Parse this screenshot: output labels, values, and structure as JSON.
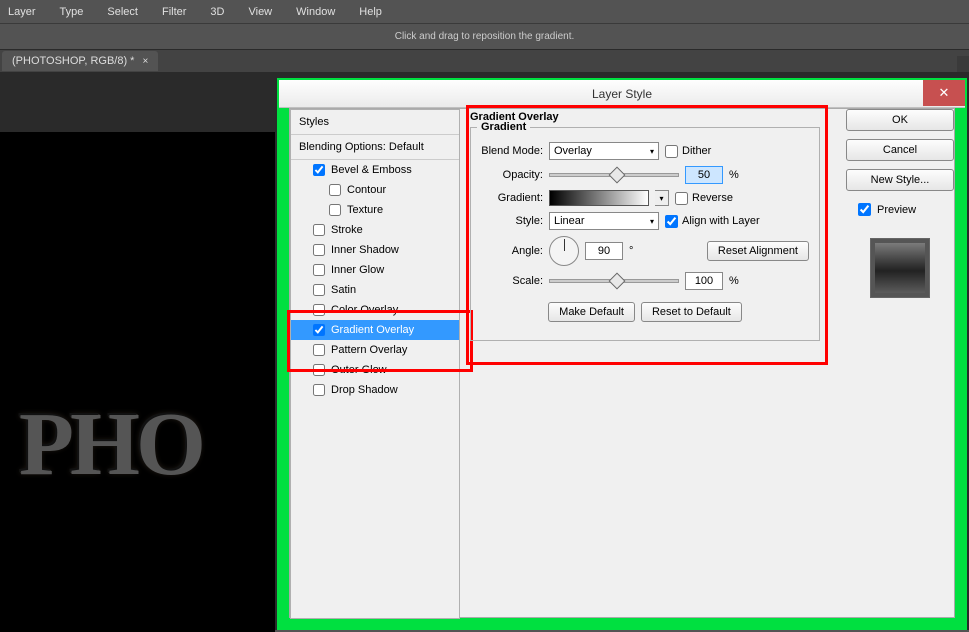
{
  "menu": [
    "Layer",
    "Type",
    "Select",
    "Filter",
    "3D",
    "View",
    "Window",
    "Help"
  ],
  "info": "Click and drag to reposition the gradient.",
  "tab": {
    "label": "(PHOTOSHOP, RGB/8) *"
  },
  "canvas_text": "PHO",
  "dialog": {
    "title": "Layer Style",
    "styles_header": "Styles",
    "blending": "Blending Options: Default",
    "items": [
      {
        "label": "Bevel & Emboss",
        "checked": true,
        "sub": false
      },
      {
        "label": "Contour",
        "checked": false,
        "sub": true
      },
      {
        "label": "Texture",
        "checked": false,
        "sub": true
      },
      {
        "label": "Stroke",
        "checked": false,
        "sub": false
      },
      {
        "label": "Inner Shadow",
        "checked": false,
        "sub": false
      },
      {
        "label": "Inner Glow",
        "checked": false,
        "sub": false
      },
      {
        "label": "Satin",
        "checked": false,
        "sub": false
      },
      {
        "label": "Color Overlay",
        "checked": false,
        "sub": false
      },
      {
        "label": "Gradient Overlay",
        "checked": true,
        "sub": false,
        "selected": true
      },
      {
        "label": "Pattern Overlay",
        "checked": false,
        "sub": false
      },
      {
        "label": "Outer Glow",
        "checked": false,
        "sub": false
      },
      {
        "label": "Drop Shadow",
        "checked": false,
        "sub": false
      }
    ],
    "section": "Gradient Overlay",
    "group": "Gradient",
    "blend_mode_label": "Blend Mode:",
    "blend_mode": "Overlay",
    "dither": "Dither",
    "opacity_label": "Opacity:",
    "opacity": "50",
    "pct": "%",
    "gradient_label": "Gradient:",
    "reverse": "Reverse",
    "style_label": "Style:",
    "style": "Linear",
    "align": "Align with Layer",
    "angle_label": "Angle:",
    "angle": "90",
    "deg": "°",
    "reset_align": "Reset Alignment",
    "scale_label": "Scale:",
    "scale": "100",
    "make_default": "Make Default",
    "reset_default": "Reset to Default",
    "ok": "OK",
    "cancel": "Cancel",
    "new_style": "New Style...",
    "preview": "Preview"
  }
}
